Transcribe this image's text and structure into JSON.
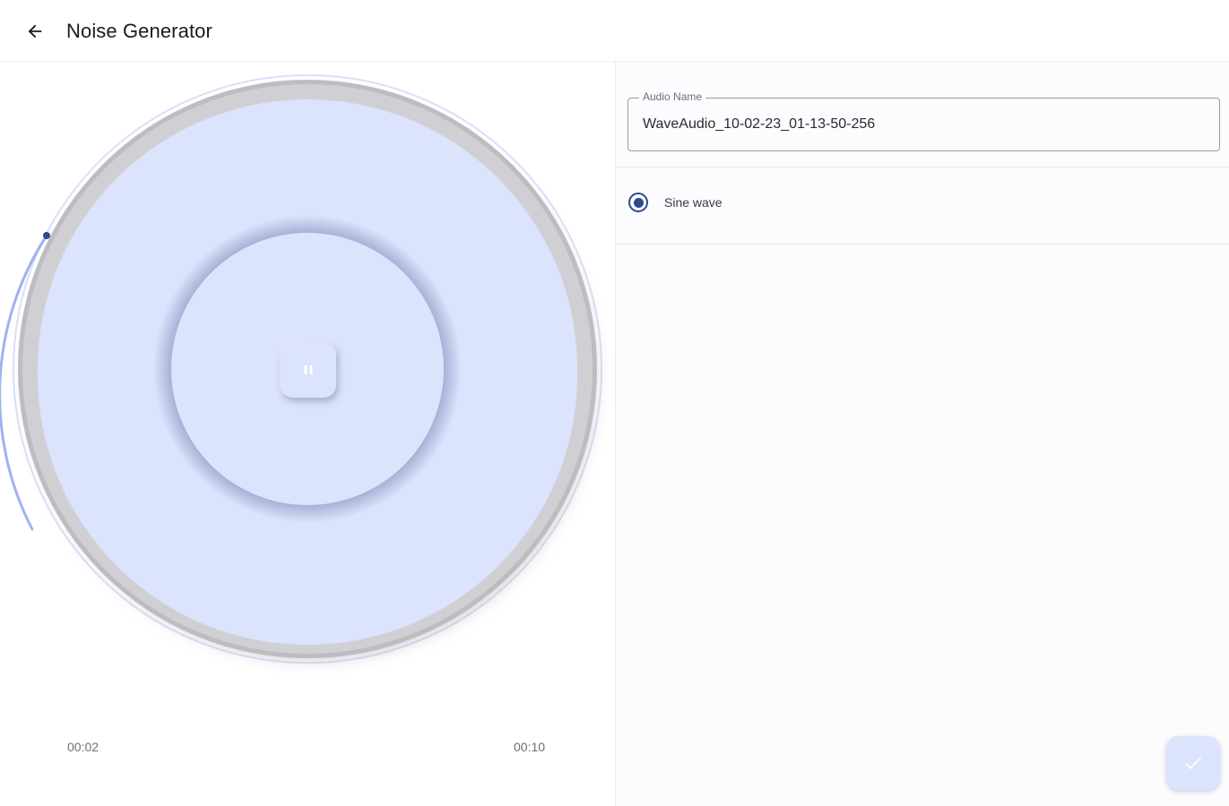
{
  "topbar": {
    "title": "Noise Generator",
    "back_icon": "arrow-back-icon"
  },
  "player": {
    "elapsed": "00:02",
    "total": "00:10",
    "progress": 0.2,
    "play_state_icon": "pause-icon",
    "colors": {
      "disc": "#dbe3fd",
      "accent": "#2b4a8f",
      "track": "#c8d3fb"
    }
  },
  "settings": {
    "audio_name_label": "Audio Name",
    "audio_name_value": "WaveAudio_10-02-23_01-13-50-256",
    "wave_options": [
      {
        "label": "Sine wave",
        "selected": true
      }
    ]
  },
  "fab": {
    "icon": "check-icon"
  }
}
